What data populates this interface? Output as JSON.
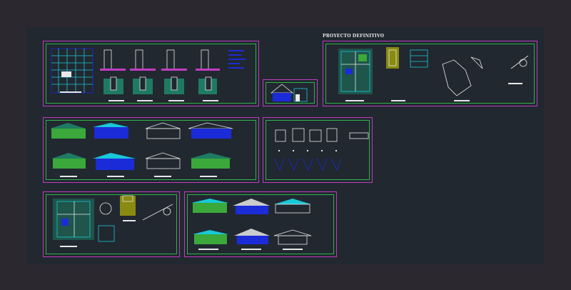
{
  "app": {
    "window": "CAD drawing viewer"
  },
  "drawing": {
    "title": "PROYECTO DEFINITIVO",
    "colors": {
      "background": "#2b2830",
      "model_space": "#212830",
      "sheet_border": "#c23cc2",
      "sheet_inner_border": "#2fb34a",
      "wall_cyan": "#19c8d8",
      "blue_fill": "#1c2bd8",
      "green": "#3aa83a",
      "yellow": "#e6d21a",
      "white": "#e8e8e8",
      "red": "#d02020",
      "olive": "#8a8a10",
      "teal_green": "#1f7a63"
    }
  },
  "sheets": [
    {
      "name": "sheet-floor-plan-and-foundation-details"
    },
    {
      "name": "sheet-small-detail"
    },
    {
      "name": "sheet-definitive-project-plan"
    },
    {
      "name": "sheet-elevations"
    },
    {
      "name": "sheet-structural-details"
    },
    {
      "name": "sheet-site-plan"
    },
    {
      "name": "sheet-colored-elevations"
    }
  ]
}
